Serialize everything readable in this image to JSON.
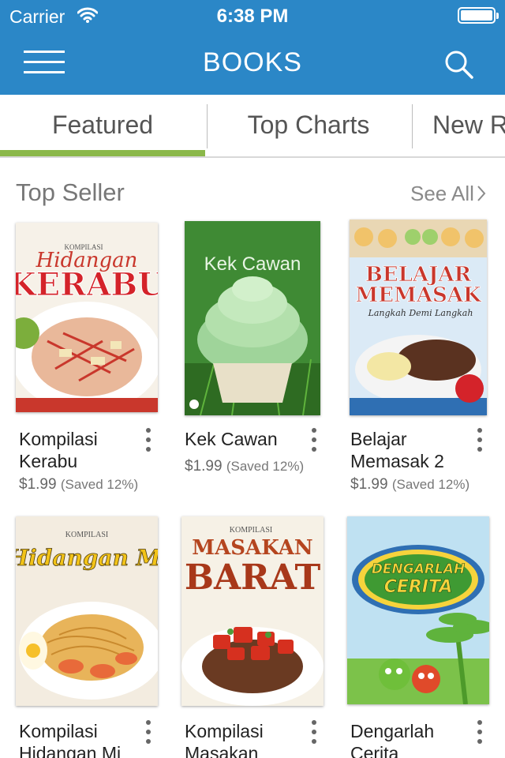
{
  "status_bar": {
    "carrier": "Carrier",
    "time": "6:38 PM",
    "wifi_icon": "wifi-icon",
    "battery_icon": "battery-icon"
  },
  "nav": {
    "title": "BOOKS",
    "menu_icon": "hamburger-menu-icon",
    "search_icon": "search-icon",
    "bar_color": "#2b87c7"
  },
  "tabs": [
    {
      "label": "Featured",
      "selected": true
    },
    {
      "label": "Top Charts",
      "selected": false
    },
    {
      "label": "New R",
      "selected": false
    }
  ],
  "tab_indicator_color": "#8bb84a",
  "section": {
    "title": "Top Seller",
    "see_all": "See All"
  },
  "books": [
    {
      "title": "Kompilasi Kerabu",
      "price": "$1.99",
      "saved": "(Saved 12%)",
      "cover_text": [
        "KOMPILASI",
        "Hidangan",
        "KERABU"
      ]
    },
    {
      "title": "Kek Cawan",
      "price": "$1.99",
      "saved": "(Saved 12%)",
      "cover_text": [
        "Kek Cawan"
      ]
    },
    {
      "title": "Belajar Memasak 2",
      "price": "$1.99",
      "saved": "(Saved 12%)",
      "cover_text": [
        "BELAJAR",
        "MEMASAK",
        "Langkah Demi Langkah"
      ]
    },
    {
      "title": "Kompilasi Hidangan Mi",
      "price": "",
      "saved": "",
      "cover_text": [
        "KOMPILASI",
        "Hidangan Mi"
      ]
    },
    {
      "title": "Kompilasi Masakan Barat",
      "price": "",
      "saved": "",
      "cover_text": [
        "KOMPILASI",
        "MASAKAN",
        "BARAT"
      ]
    },
    {
      "title": "Dengarlah Cerita",
      "price": "",
      "saved": "",
      "cover_text": [
        "DENGARLAH",
        "CERITA"
      ]
    }
  ]
}
